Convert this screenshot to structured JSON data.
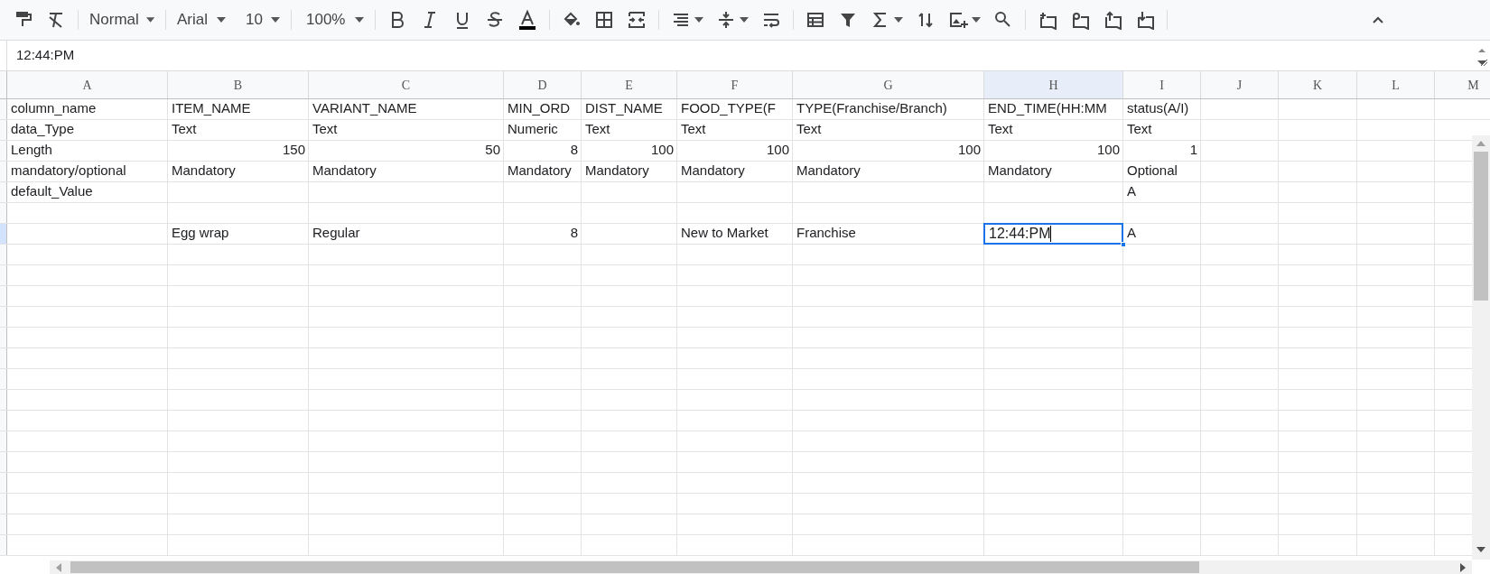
{
  "toolbar": {
    "style": "Normal",
    "font": "Arial",
    "font_size": "10",
    "zoom": "100%"
  },
  "formula_bar": {
    "value": "12:44:PM"
  },
  "columns": [
    {
      "label": "A",
      "selected": false
    },
    {
      "label": "B",
      "selected": false
    },
    {
      "label": "C",
      "selected": false
    },
    {
      "label": "D",
      "selected": false
    },
    {
      "label": "E",
      "selected": false
    },
    {
      "label": "F",
      "selected": false
    },
    {
      "label": "G",
      "selected": false
    },
    {
      "label": "H",
      "selected": true
    },
    {
      "label": "I",
      "selected": false
    },
    {
      "label": "J",
      "selected": false
    },
    {
      "label": "K",
      "selected": false
    },
    {
      "label": "L",
      "selected": false
    },
    {
      "label": "M",
      "selected": false
    }
  ],
  "rows": [
    {
      "selected": false,
      "cells": [
        {
          "text": "column_name",
          "kind": "text",
          "selected": false
        },
        {
          "text": "ITEM_NAME",
          "kind": "text",
          "selected": false
        },
        {
          "text": "VARIANT_NAME",
          "kind": "text",
          "selected": false
        },
        {
          "text": "MIN_ORD",
          "kind": "text",
          "selected": false
        },
        {
          "text": "DIST_NAME",
          "kind": "text",
          "selected": false
        },
        {
          "text": "FOOD_TYPE(F",
          "kind": "text",
          "selected": false
        },
        {
          "text": "TYPE(Franchise/Branch)",
          "kind": "text",
          "selected": false
        },
        {
          "text": "END_TIME(HH:MM",
          "kind": "text",
          "selected": false
        },
        {
          "text": "status(A/I)",
          "kind": "text",
          "selected": false
        }
      ]
    },
    {
      "selected": false,
      "cells": [
        {
          "text": "data_Type",
          "kind": "text",
          "selected": false
        },
        {
          "text": "Text",
          "kind": "text",
          "selected": false
        },
        {
          "text": "Text",
          "kind": "text",
          "selected": false
        },
        {
          "text": "Numeric",
          "kind": "text",
          "selected": false
        },
        {
          "text": "Text",
          "kind": "text",
          "selected": false
        },
        {
          "text": "Text",
          "kind": "text",
          "selected": false
        },
        {
          "text": "Text",
          "kind": "text",
          "selected": false
        },
        {
          "text": "Text",
          "kind": "text",
          "selected": false
        },
        {
          "text": "Text",
          "kind": "text",
          "selected": false
        }
      ]
    },
    {
      "selected": false,
      "cells": [
        {
          "text": "Length",
          "kind": "text",
          "selected": false
        },
        {
          "text": "150",
          "kind": "number",
          "selected": false
        },
        {
          "text": "50",
          "kind": "number",
          "selected": false
        },
        {
          "text": "8",
          "kind": "number",
          "selected": false
        },
        {
          "text": "100",
          "kind": "number",
          "selected": false
        },
        {
          "text": "100",
          "kind": "number",
          "selected": false
        },
        {
          "text": "100",
          "kind": "number",
          "selected": false
        },
        {
          "text": "100",
          "kind": "number",
          "selected": false
        },
        {
          "text": "1",
          "kind": "number",
          "selected": false
        }
      ]
    },
    {
      "selected": false,
      "cells": [
        {
          "text": "mandatory/optional",
          "kind": "text",
          "selected": false
        },
        {
          "text": "Mandatory",
          "kind": "text",
          "selected": false
        },
        {
          "text": "Mandatory",
          "kind": "text",
          "selected": false
        },
        {
          "text": "Mandatory",
          "kind": "text",
          "selected": false
        },
        {
          "text": "Mandatory",
          "kind": "text",
          "selected": false
        },
        {
          "text": "Mandatory",
          "kind": "text",
          "selected": false
        },
        {
          "text": "Mandatory",
          "kind": "text",
          "selected": false
        },
        {
          "text": "Mandatory",
          "kind": "text",
          "selected": false
        },
        {
          "text": "Optional",
          "kind": "text",
          "selected": false
        }
      ]
    },
    {
      "selected": false,
      "cells": [
        {
          "text": "default_Value",
          "kind": "text",
          "selected": false
        },
        null,
        null,
        null,
        null,
        null,
        null,
        null,
        {
          "text": "A",
          "kind": "text",
          "selected": false
        }
      ]
    },
    {
      "selected": false,
      "cells": []
    },
    {
      "selected": true,
      "cells": [
        null,
        {
          "text": "Egg wrap",
          "kind": "text",
          "selected": false
        },
        {
          "text": "Regular",
          "kind": "text",
          "selected": false
        },
        {
          "text": "8",
          "kind": "number",
          "selected": false
        },
        null,
        {
          "text": "New to Market",
          "kind": "text",
          "selected": false
        },
        {
          "text": "Franchise",
          "kind": "text",
          "selected": false
        },
        {
          "text": "12:44:PM",
          "kind": "text",
          "selected": true,
          "editing": true
        },
        {
          "text": "A",
          "kind": "text",
          "selected": false
        }
      ]
    }
  ]
}
